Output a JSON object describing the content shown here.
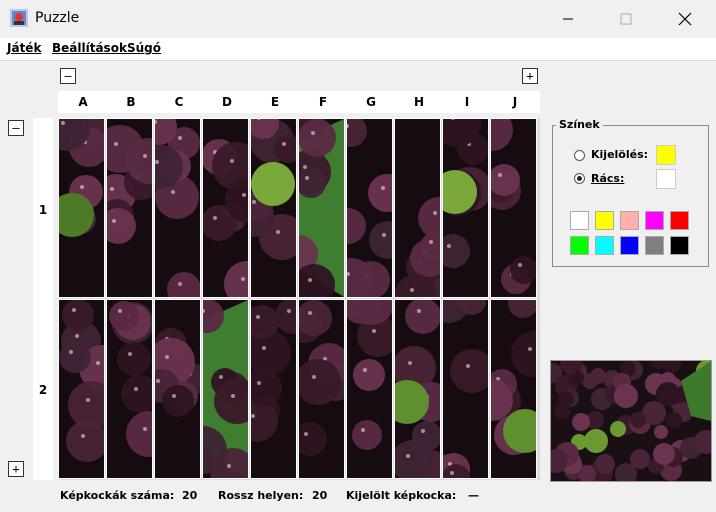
{
  "window": {
    "title": "Puzzle",
    "icon": "puzzle-app-icon"
  },
  "menu": {
    "game": "Játék",
    "settings": "Beállítások",
    "help": "Súgó"
  },
  "controls": {
    "minus_symbol": "–",
    "plus_symbol": "+"
  },
  "grid": {
    "columns": [
      "A",
      "B",
      "C",
      "D",
      "E",
      "F",
      "G",
      "H",
      "I",
      "J"
    ],
    "rows": [
      "1",
      "2"
    ]
  },
  "status": {
    "tiles_label": "Képkockák száma:",
    "tiles_value": "20",
    "wrong_label": "Rossz helyen:",
    "wrong_value": "20",
    "selected_label": "Kijelölt képkocka:",
    "selected_value": "—"
  },
  "colors_panel": {
    "legend": "Színek",
    "selection_label": "Kijelölés:",
    "selection_color": "#ffff00",
    "grid_label": "Rács:",
    "grid_color": "#ffffff",
    "selected_option": "grid",
    "palette": [
      "#ffffff",
      "#ffff00",
      "#ffafaf",
      "#ff00ff",
      "#ff0000",
      "#00ff00",
      "#00ffff",
      "#0000ff",
      "#808080",
      "#000000"
    ]
  }
}
